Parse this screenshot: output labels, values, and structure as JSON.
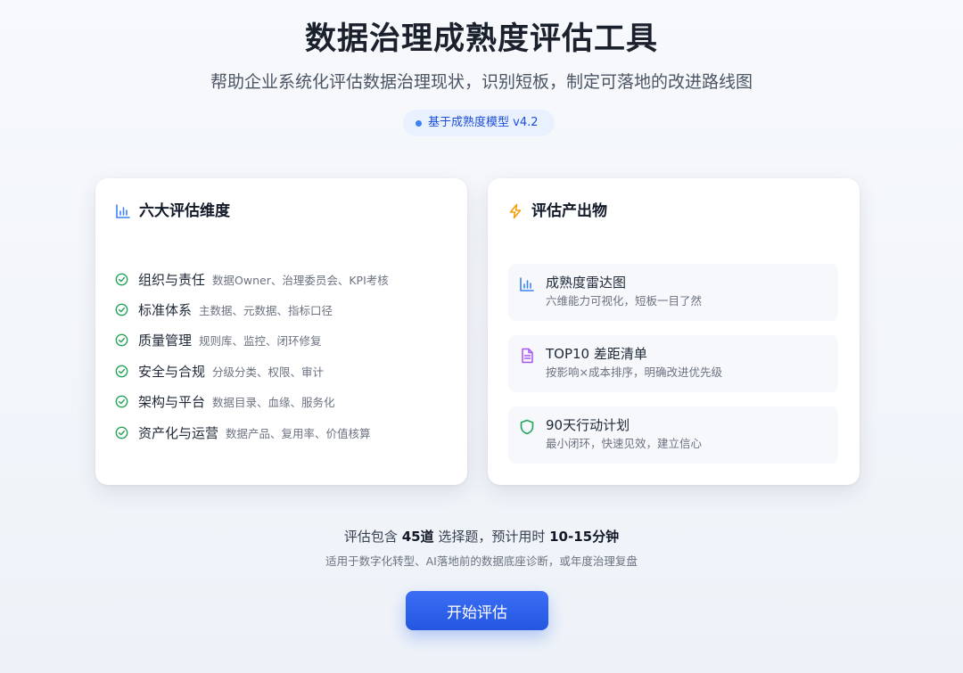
{
  "header": {
    "title": "数据治理成熟度评估工具",
    "subtitle": "帮助企业系统化评估数据治理现状，识别短板，制定可落地的改进路线图",
    "badge": "基于成熟度模型 v4.2"
  },
  "colors": {
    "accent": "#2563eb",
    "check": "#22a35a",
    "bar_icon": "#3b82f6",
    "bolt_icon": "#f59e0b",
    "doc_icon": "#a855f7",
    "shield_icon": "#22a35a"
  },
  "dimensions": {
    "title": "六大评估维度",
    "icon": "bar-chart-icon",
    "items": [
      {
        "name": "组织与责任",
        "desc": "数据Owner、治理委员会、KPI考核"
      },
      {
        "name": "标准体系",
        "desc": "主数据、元数据、指标口径"
      },
      {
        "name": "质量管理",
        "desc": "规则库、监控、闭环修复"
      },
      {
        "name": "安全与合规",
        "desc": "分级分类、权限、审计"
      },
      {
        "name": "架构与平台",
        "desc": "数据目录、血缘、服务化"
      },
      {
        "name": "资产化与运营",
        "desc": "数据产品、复用率、价值核算"
      }
    ]
  },
  "outputs": {
    "title": "评估产出物",
    "icon": "lightning-icon",
    "items": [
      {
        "name": "成熟度雷达图",
        "desc": "六维能力可视化，短板一目了然",
        "icon": "bar-chart-icon"
      },
      {
        "name": "TOP10 差距清单",
        "desc": "按影响×成本排序，明确改进优先级",
        "icon": "document-icon"
      },
      {
        "name": "90天行动计划",
        "desc": "最小闭环，快速见效，建立信心",
        "icon": "shield-icon"
      }
    ]
  },
  "summary": {
    "prefix": "评估包含 ",
    "questions": "45道",
    "middle": " 选择题，预计用时 ",
    "duration": "10-15分钟",
    "note": "适用于数字化转型、AI落地前的数据底座诊断，或年度治理复盘"
  },
  "start_button": "开始评估"
}
